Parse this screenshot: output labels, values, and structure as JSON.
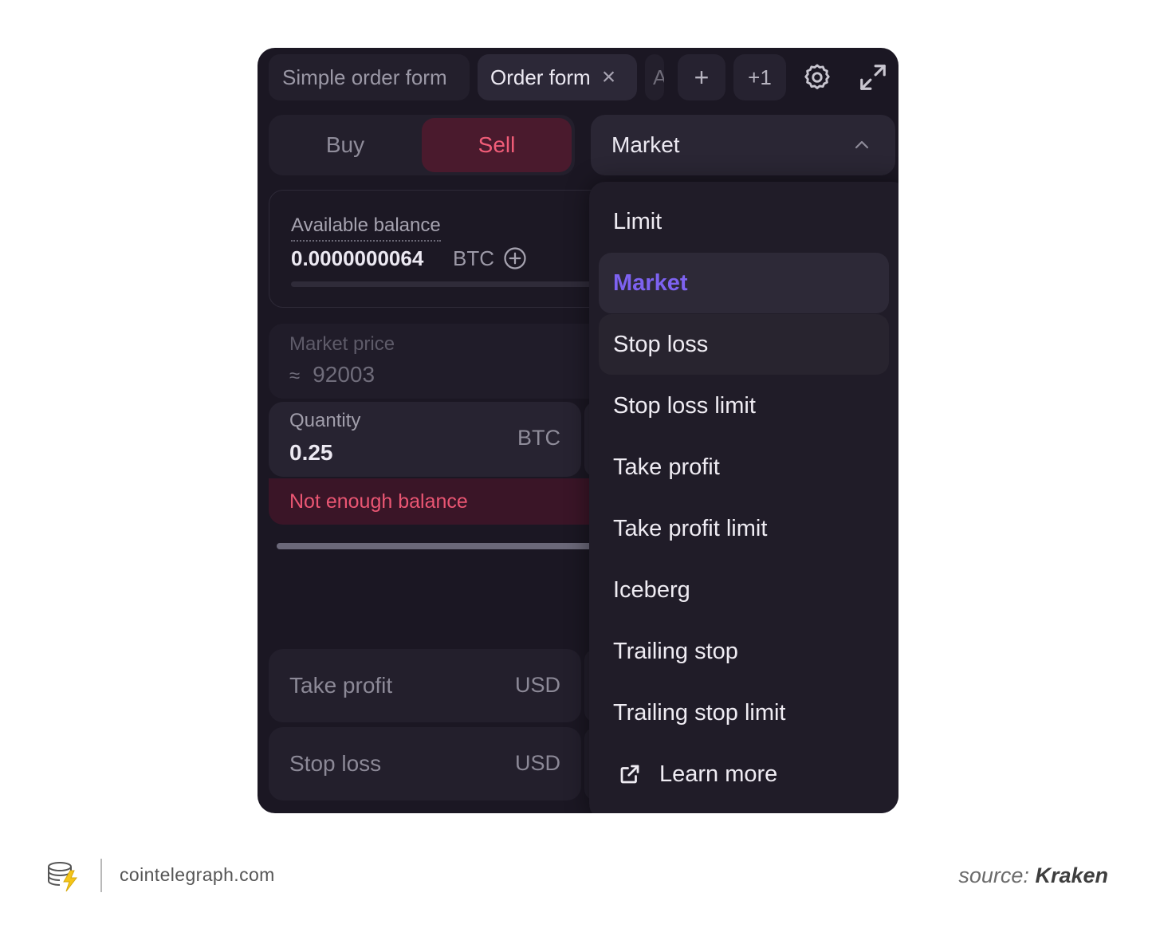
{
  "tabs": {
    "simple": "Simple order form",
    "order": "Order form",
    "partial": "A",
    "add": "+",
    "more": "+1"
  },
  "order_side": {
    "buy": "Buy",
    "sell": "Sell",
    "selected": "Sell"
  },
  "order_type": {
    "selected": "Market",
    "options": [
      "Limit",
      "Market",
      "Stop loss",
      "Stop loss limit",
      "Take profit",
      "Take profit limit",
      "Iceberg",
      "Trailing stop",
      "Trailing stop limit"
    ],
    "learn_more": "Learn more"
  },
  "balance": {
    "label": "Available balance",
    "value": "0.0000000064",
    "unit": "BTC"
  },
  "market_price": {
    "label": "Market price",
    "approx": "≈",
    "value": "92003"
  },
  "quantity": {
    "label": "Quantity",
    "value": "0.25",
    "unit": "BTC",
    "error": "Not enough balance"
  },
  "take_profit": {
    "label": "Take profit",
    "unit": "USD"
  },
  "stop_loss": {
    "label": "Stop loss",
    "unit": "USD"
  },
  "footer": {
    "site": "cointelegraph.com",
    "source_label": "source:",
    "source_name": "Kraken"
  },
  "colors": {
    "sell_accent": "#f15d78",
    "selected_option": "#7d62f0",
    "error": "#ea5673",
    "panel_bg": "#1b1723"
  }
}
